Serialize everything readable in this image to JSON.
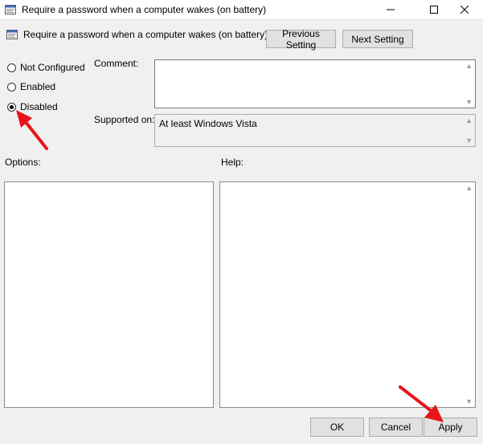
{
  "window": {
    "title": "Require a password when a computer wakes (on battery)",
    "minimize_glyph": "—",
    "maximize_glyph": "☐",
    "close_glyph": "✕"
  },
  "header": {
    "policy_name": "Require a password when a computer wakes (on battery)",
    "previous_label": "Previous Setting",
    "next_label": "Next Setting"
  },
  "state": {
    "options": [
      {
        "label": "Not Configured",
        "checked": false
      },
      {
        "label": "Enabled",
        "checked": false
      },
      {
        "label": "Disabled",
        "checked": true
      }
    ]
  },
  "comment": {
    "label": "Comment:",
    "value": ""
  },
  "supported": {
    "label": "Supported on:",
    "value": "At least Windows Vista"
  },
  "options_panel": {
    "label": "Options:"
  },
  "help_panel": {
    "label": "Help:"
  },
  "footer": {
    "ok_label": "OK",
    "cancel_label": "Cancel",
    "apply_label": "Apply"
  },
  "annotations": {
    "arrow_color": "#e8141b"
  }
}
